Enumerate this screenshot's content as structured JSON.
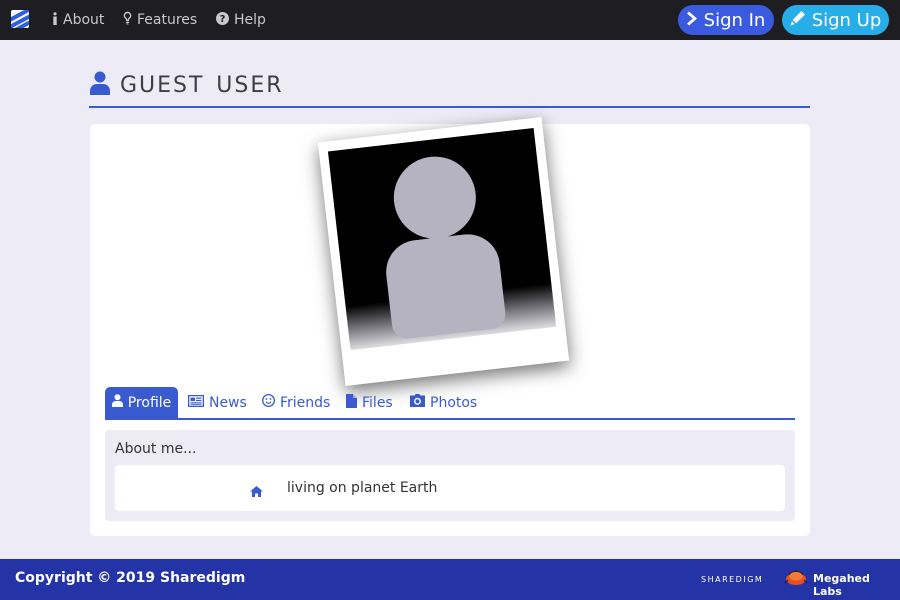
{
  "navbar": {
    "logo_icon": "sharedigm-logo-icon",
    "links": [
      {
        "label": "About",
        "icon": "info-icon"
      },
      {
        "label": "Features",
        "icon": "lightbulb-icon"
      },
      {
        "label": "Help",
        "icon": "question-circle-icon"
      }
    ],
    "sign_in": {
      "label": "Sign In",
      "icon": "chevron-right-icon",
      "color": "#3a5be0"
    },
    "sign_up": {
      "label": "Sign Up",
      "icon": "pencil-icon",
      "color": "#27aee8"
    }
  },
  "page": {
    "title": "Guest User",
    "title_icon": "user-icon"
  },
  "profile": {
    "photo_icon": "user-avatar-placeholder-icon",
    "tabs": [
      {
        "label": "Profile",
        "icon": "user-icon",
        "active": true
      },
      {
        "label": "News",
        "icon": "newspaper-icon",
        "active": false
      },
      {
        "label": "Friends",
        "icon": "smile-icon",
        "active": false
      },
      {
        "label": "Files",
        "icon": "file-icon",
        "active": false
      },
      {
        "label": "Photos",
        "icon": "camera-icon",
        "active": false
      }
    ],
    "about": {
      "heading": "About me...",
      "location_icon": "home-icon",
      "location": "living on planet Earth"
    }
  },
  "footer": {
    "copyright": "Copyright © 2019 Sharedigm",
    "brand": "sharedigm",
    "lab_icon": "megahed-labs-logo-icon",
    "lab": "Megahed Labs"
  },
  "colors": {
    "accent": "#3a5bd0",
    "navbar": "#1e1e22",
    "footer": "#2433a6",
    "background": "#ecebf6"
  }
}
